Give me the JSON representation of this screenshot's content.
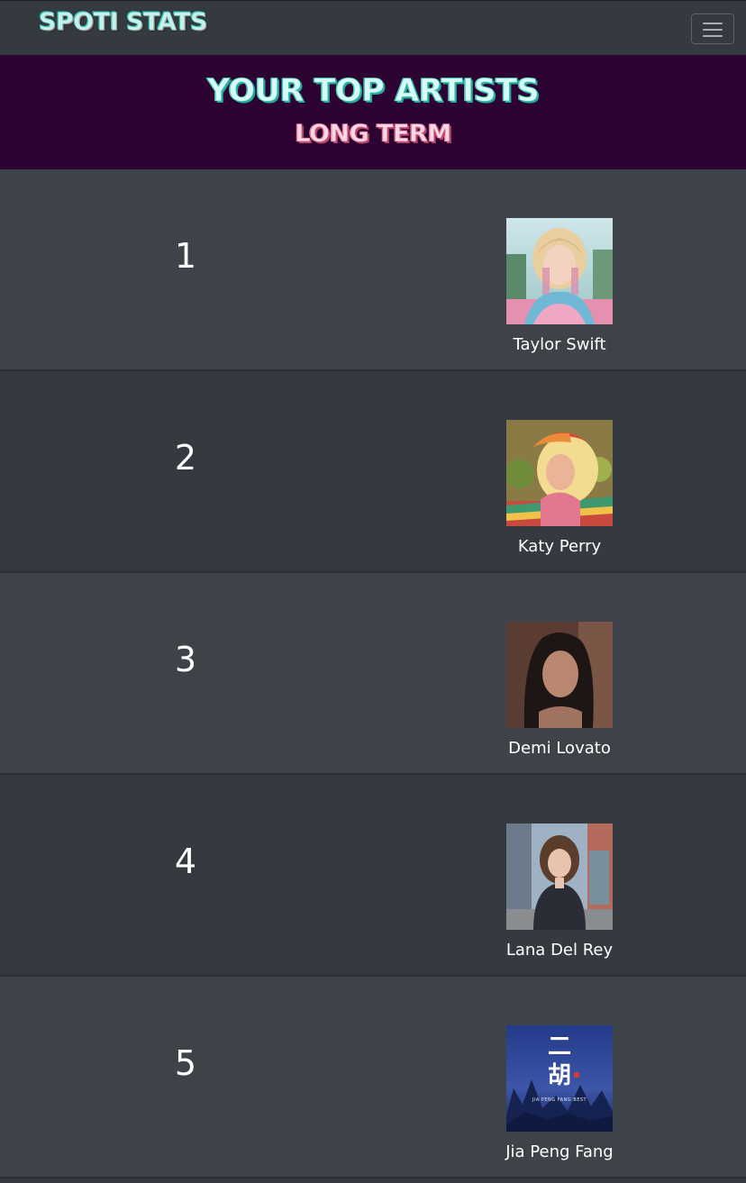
{
  "navbar": {
    "brand": "SPOTI STATS",
    "menu_icon": "hamburger-menu-icon"
  },
  "hero": {
    "title": "YOUR TOP ARTISTS",
    "subtitle": "LONG TERM"
  },
  "artists": [
    {
      "rank": "1",
      "name": "Taylor Swift"
    },
    {
      "rank": "2",
      "name": "Katy Perry"
    },
    {
      "rank": "3",
      "name": "Demi Lovato"
    },
    {
      "rank": "4",
      "name": "Lana Del Rey"
    },
    {
      "rank": "5",
      "name": "Jia Peng Fang"
    }
  ],
  "album_art_5": {
    "big_char": "二\n胡",
    "caption": "JIA PENG FANG BEST"
  },
  "colors": {
    "navbar_bg": "#343a40",
    "hero_bg": "#2d0331",
    "row_light": "#3e4349",
    "row_dark": "#343a40",
    "accent_teal": "#32c0b3",
    "accent_pink": "#d95c86"
  }
}
